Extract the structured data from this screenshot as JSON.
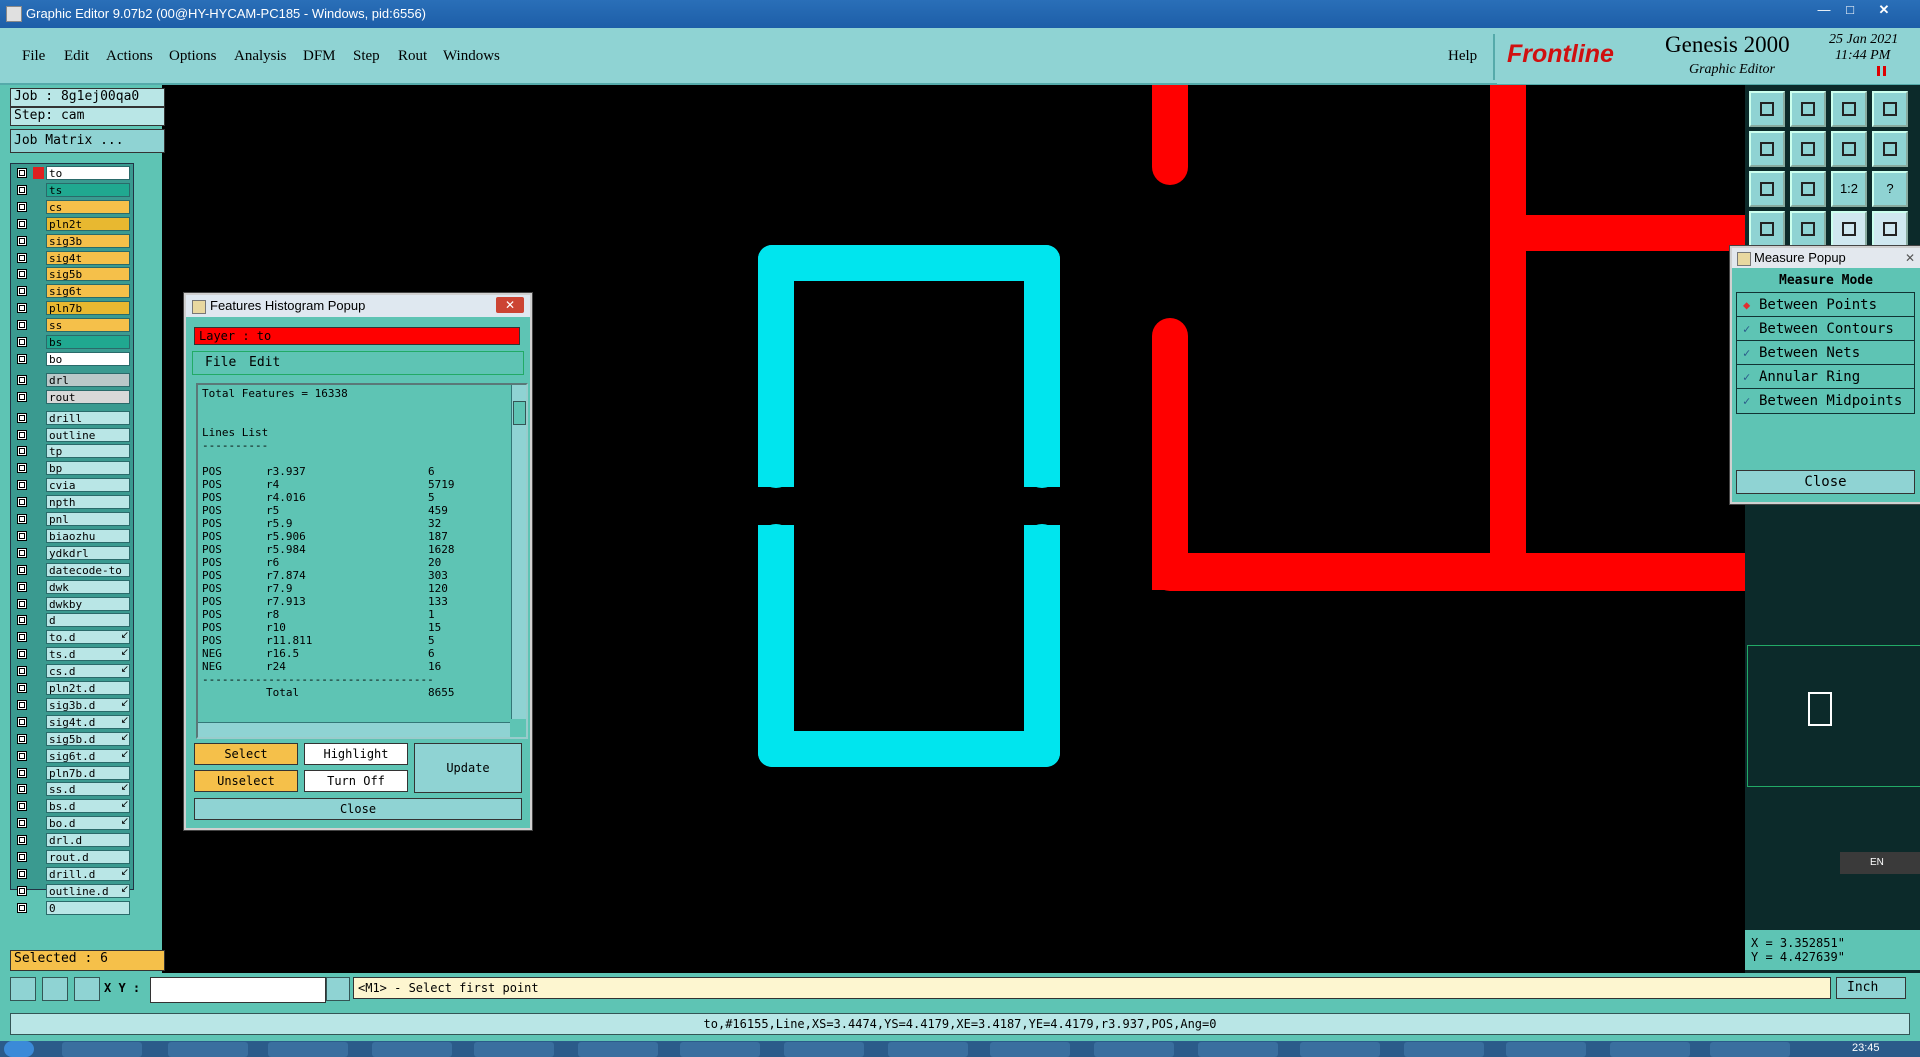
{
  "window": {
    "title": "Graphic Editor 9.07b2 (00@HY-HYCAM-PC185 - Windows, pid:6556)"
  },
  "menu": {
    "items": [
      "File",
      "Edit",
      "Actions",
      "Options",
      "Analysis",
      "DFM",
      "Step",
      "Rout",
      "Windows"
    ],
    "help": "Help"
  },
  "brand": {
    "logo": "Frontline",
    "product": "Genesis 2000",
    "subtitle": "Graphic Editor",
    "date": "25 Jan 2021",
    "time": "11:44 PM"
  },
  "job": {
    "job_label": "Job : 8g1ej00qa0",
    "step_label": "Step: cam",
    "matrix_button": "Job Matrix ..."
  },
  "layers": [
    {
      "name": "to",
      "color": "#ffffff",
      "active": true
    },
    {
      "name": "ts",
      "color": "#20a890"
    },
    {
      "name": "cs",
      "color": "#f5c04a"
    },
    {
      "name": "pln2t",
      "color": "#e8b830"
    },
    {
      "name": "sig3b",
      "color": "#f5c04a"
    },
    {
      "name": "sig4t",
      "color": "#f5c04a"
    },
    {
      "name": "sig5b",
      "color": "#f5c04a"
    },
    {
      "name": "sig6t",
      "color": "#f5c04a"
    },
    {
      "name": "pln7b",
      "color": "#e8b830"
    },
    {
      "name": "ss",
      "color": "#f5c04a"
    },
    {
      "name": "bs",
      "color": "#20a890"
    },
    {
      "name": "bo",
      "color": "#ffffff"
    },
    {
      "name": "drl",
      "color": "#b9c8c8",
      "gap": true
    },
    {
      "name": "rout",
      "color": "#d8d8d8"
    },
    {
      "name": "drill",
      "color": "#b9e6e6",
      "gap": true
    },
    {
      "name": "outline",
      "color": "#b9e6e6"
    },
    {
      "name": "tp",
      "color": "#b9e6e6"
    },
    {
      "name": "bp",
      "color": "#b9e6e6"
    },
    {
      "name": "cvia",
      "color": "#b9e6e6"
    },
    {
      "name": "npth",
      "color": "#b9e6e6"
    },
    {
      "name": "pnl",
      "color": "#b9e6e6"
    },
    {
      "name": "biaozhu",
      "color": "#b9e6e6"
    },
    {
      "name": "ydkdrl",
      "color": "#b9e6e6"
    },
    {
      "name": "datecode-to",
      "color": "#b9e6e6"
    },
    {
      "name": "dwk",
      "color": "#b9e6e6"
    },
    {
      "name": "dwkby",
      "color": "#b9e6e6"
    },
    {
      "name": "d",
      "color": "#b9e6e6"
    },
    {
      "name": "to.d",
      "color": "#b9e6e6",
      "arrow": true
    },
    {
      "name": "ts.d",
      "color": "#b9e6e6",
      "arrow": true
    },
    {
      "name": "cs.d",
      "color": "#b9e6e6",
      "arrow": true
    },
    {
      "name": "pln2t.d",
      "color": "#b9e6e6"
    },
    {
      "name": "sig3b.d",
      "color": "#b9e6e6",
      "arrow": true
    },
    {
      "name": "sig4t.d",
      "color": "#b9e6e6",
      "arrow": true
    },
    {
      "name": "sig5b.d",
      "color": "#b9e6e6",
      "arrow": true
    },
    {
      "name": "sig6t.d",
      "color": "#b9e6e6",
      "arrow": true
    },
    {
      "name": "pln7b.d",
      "color": "#b9e6e6"
    },
    {
      "name": "ss.d",
      "color": "#b9e6e6",
      "arrow": true
    },
    {
      "name": "bs.d",
      "color": "#b9e6e6",
      "arrow": true
    },
    {
      "name": "bo.d",
      "color": "#b9e6e6",
      "arrow": true
    },
    {
      "name": "drl.d",
      "color": "#b9e6e6"
    },
    {
      "name": "rout.d",
      "color": "#b9e6e6"
    },
    {
      "name": "drill.d",
      "color": "#b9e6e6",
      "arrow": true
    },
    {
      "name": "outline.d",
      "color": "#b9e6e6",
      "arrow": true
    },
    {
      "name": "0",
      "color": "#b9e6e6"
    }
  ],
  "selected": "Selected : 6",
  "histogram": {
    "title": "Features Histogram Popup",
    "layer": "Layer :  to",
    "menu": [
      "File",
      "Edit"
    ],
    "total": "Total Features = 16338",
    "list_title": "Lines List",
    "underline": "----------",
    "rows": [
      [
        "POS",
        "r3.937",
        "6"
      ],
      [
        "POS",
        "r4",
        "5719"
      ],
      [
        "POS",
        "r4.016",
        "5"
      ],
      [
        "POS",
        "r5",
        "459"
      ],
      [
        "POS",
        "r5.9",
        "32"
      ],
      [
        "POS",
        "r5.906",
        "187"
      ],
      [
        "POS",
        "r5.984",
        "1628"
      ],
      [
        "POS",
        "r6",
        "20"
      ],
      [
        "POS",
        "r7.874",
        "303"
      ],
      [
        "POS",
        "r7.9",
        "120"
      ],
      [
        "POS",
        "r7.913",
        "133"
      ],
      [
        "POS",
        "r8",
        "1"
      ],
      [
        "POS",
        "r10",
        "15"
      ],
      [
        "POS",
        "r11.811",
        "5"
      ],
      [
        "NEG",
        "r16.5",
        "6"
      ],
      [
        "NEG",
        "r24",
        "16"
      ]
    ],
    "separator": "-----------------------------------",
    "total_row": [
      "",
      "Total",
      "8655"
    ],
    "buttons": {
      "select": "Select",
      "unselect": "Unselect",
      "highlight": "Highlight",
      "turnoff": "Turn Off",
      "update": "Update",
      "close": "Close"
    }
  },
  "measure": {
    "title": "Measure Popup",
    "header": "Measure Mode",
    "modes": [
      "Between Points",
      "Between Contours",
      "Between Nets",
      "Annular Ring",
      "Between Midpoints"
    ],
    "selected_mode": "Between Points",
    "close": "Close"
  },
  "toolbar_icons": [
    "home-up-icon",
    "home-down-icon",
    "house-icon",
    "split-view-icon",
    "pan-left-icon",
    "pan-right-icon",
    "snap-icon",
    "s-curve-icon",
    "zoom-fit-icon",
    "zoom-move-icon",
    "ratio-icon",
    "help-icon",
    "tool-icon",
    "probe-icon",
    "net-icon",
    "net-active-icon"
  ],
  "toolbar_labels": {
    "ratio": "1:2",
    "help": "?"
  },
  "coords": {
    "x": "X = 3.352851\"",
    "y": "Y = 4.427639\""
  },
  "lang": "EN",
  "bottom": {
    "xy_label": "X Y :",
    "xy_value": "",
    "prompt": "<M1> - Select first point",
    "units": "Inch"
  },
  "status": "to,#16155,Line,XS=3.4474,YS=4.4179,XE=3.4187,YE=4.4179,r3.937,POS,Ang=0",
  "clock": "23:45"
}
